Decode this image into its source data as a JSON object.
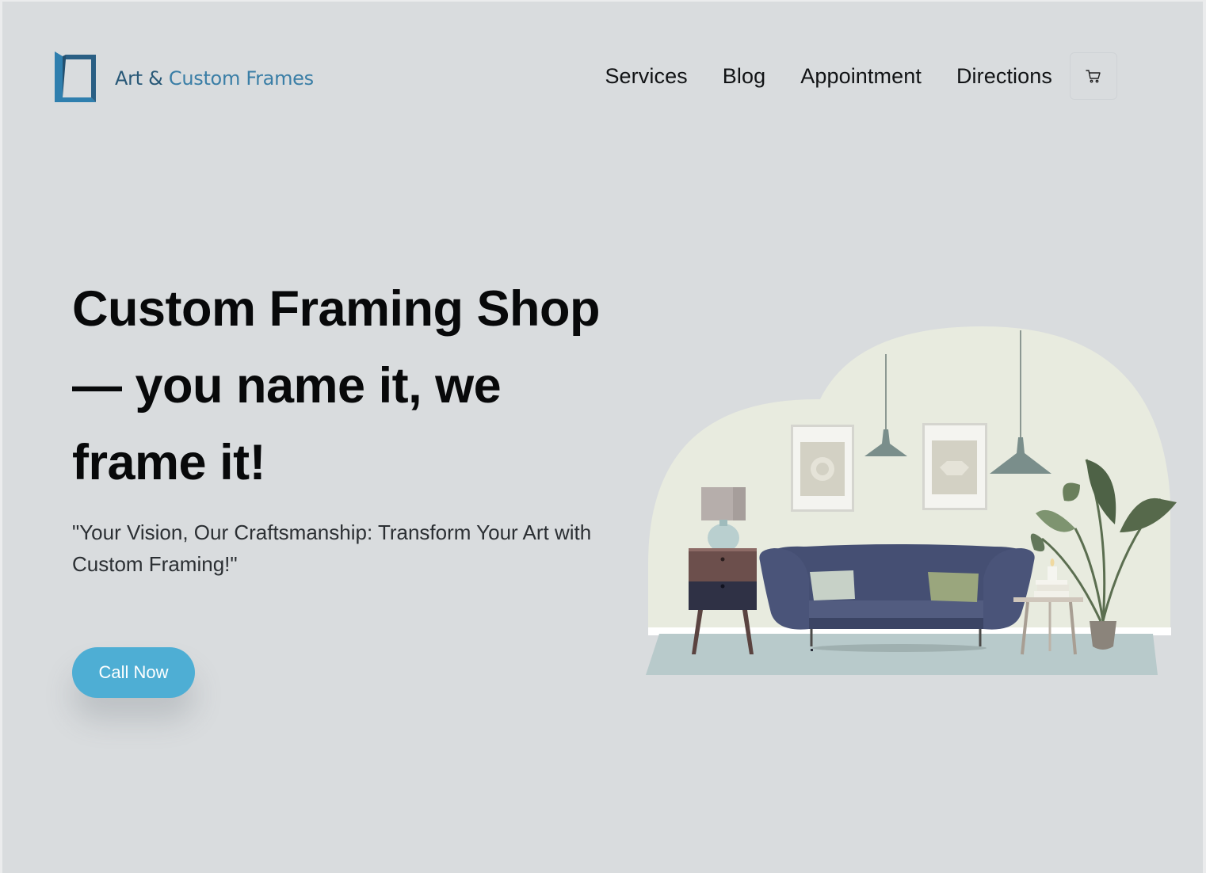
{
  "brand": {
    "name_part1": "Art & ",
    "name_part2": "Custom Frames"
  },
  "nav": {
    "items": [
      "Services",
      "Blog",
      "Appointment",
      "Directions"
    ]
  },
  "hero": {
    "title": "Custom Framing Shop — you name it, we frame it!",
    "subtitle": "\"Your Vision, Our Craftsmanship: Transform Your Art with Custom Framing!\"",
    "cta_label": "Call Now"
  },
  "colors": {
    "background": "#d9dcde",
    "accent": "#4eaed4",
    "brand": "#2b5d7d"
  }
}
